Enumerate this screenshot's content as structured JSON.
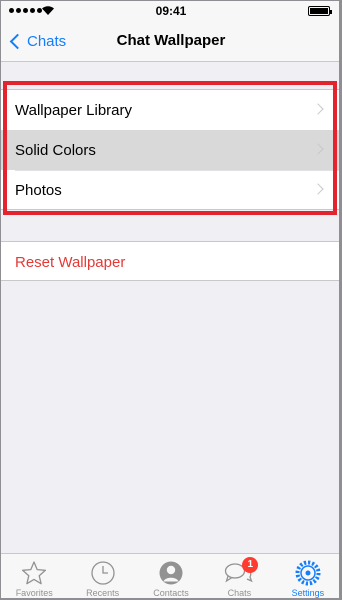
{
  "status_bar": {
    "time": "09:41"
  },
  "nav": {
    "back_label": "Chats",
    "title": "Chat Wallpaper"
  },
  "wallpaper_options": [
    {
      "label": "Wallpaper Library"
    },
    {
      "label": "Solid Colors",
      "selected": true
    },
    {
      "label": "Photos"
    }
  ],
  "reset": {
    "label": "Reset Wallpaper"
  },
  "tab_bar": {
    "tabs": [
      {
        "label": "Favorites",
        "icon": "star-icon"
      },
      {
        "label": "Recents",
        "icon": "clock-icon"
      },
      {
        "label": "Contacts",
        "icon": "person-icon"
      },
      {
        "label": "Chats",
        "icon": "chat-bubbles-icon",
        "badge": "1"
      },
      {
        "label": "Settings",
        "icon": "gear-icon",
        "active": true
      }
    ]
  },
  "colors": {
    "accent": "#157efb",
    "destructive": "#e53935",
    "highlight_box": "#e3232e",
    "badge": "#ff3b30"
  }
}
